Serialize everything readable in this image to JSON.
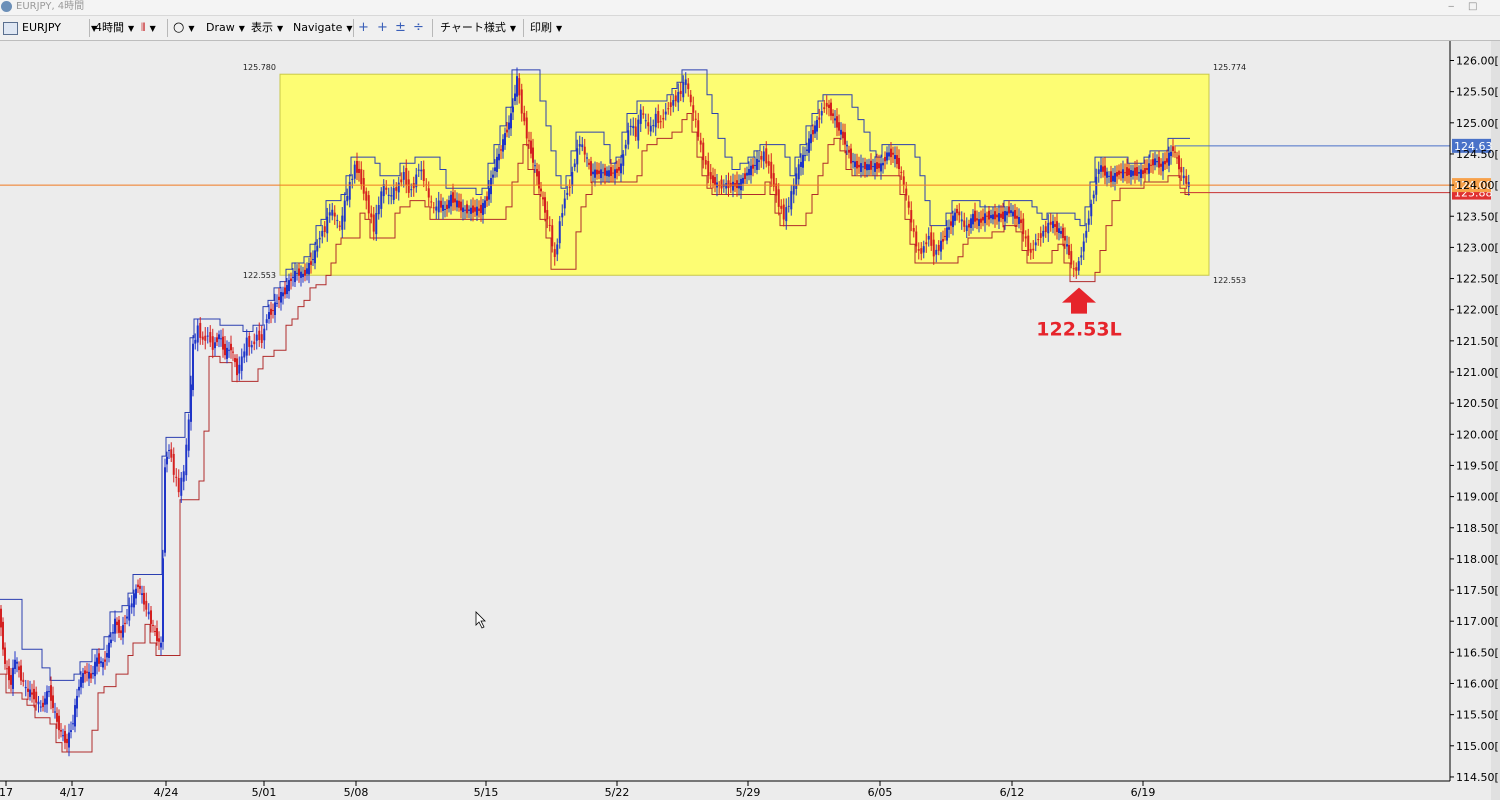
{
  "window": {
    "title": "EURJPY, 4時間",
    "minimize": "‒",
    "maximize": "□"
  },
  "toolbar": {
    "symbol": "EURJPY",
    "timeframe": "4時間",
    "draw": "Draw",
    "view": "表示",
    "navigate": "Navigate",
    "chart_style": "チャート様式",
    "print": "印刷"
  },
  "chart": {
    "range_box": {
      "high_left": "125.780",
      "high_right": "125.774",
      "low_left": "122.553",
      "low_right": "122.553"
    },
    "annotation": "122.53L",
    "price_labels": {
      "high": "124.63",
      "current": "124.00",
      "low": "123.88"
    },
    "colors": {
      "box": "#ffff66",
      "up": "#1f35c8",
      "down": "#d42020",
      "current_line": "#f07a20",
      "arrow": "#e6242b"
    },
    "cursor": "arrow-cursor"
  },
  "chart_data": {
    "type": "candlestick",
    "symbol": "EURJPY",
    "timeframe": "4時間",
    "y_ticks": [
      "126.00[",
      "125.50[",
      "125.00[",
      "124.50[",
      "124.00[",
      "123.50[",
      "123.00[",
      "122.50[",
      "122.00[",
      "121.50[",
      "121.00[",
      "120.50[",
      "120.00[",
      "119.50[",
      "119.00[",
      "118.50[",
      "118.00[",
      "117.50[",
      "117.00[",
      "116.50[",
      "116.00[",
      "115.50[",
      "115.00[",
      "114.50["
    ],
    "ylim": [
      114.5,
      126.2
    ],
    "x_ticks": [
      "17",
      "4/17",
      "4/24",
      "5/01",
      "5/08",
      "5/15",
      "5/22",
      "5/29",
      "6/05",
      "6/12",
      "6/19"
    ],
    "range_high": 125.78,
    "range_low": 122.553,
    "current_price": 124.0,
    "marked_low": 122.53,
    "path": [
      [
        0,
        117.2
      ],
      [
        6,
        116.3
      ],
      [
        12,
        116.0
      ],
      [
        16,
        116.4
      ],
      [
        22,
        116.1
      ],
      [
        27,
        115.9
      ],
      [
        35,
        115.8
      ],
      [
        42,
        115.6
      ],
      [
        50,
        115.9
      ],
      [
        56,
        115.5
      ],
      [
        62,
        115.2
      ],
      [
        68,
        115.05
      ],
      [
        74,
        115.4
      ],
      [
        80,
        116.0
      ],
      [
        86,
        116.2
      ],
      [
        92,
        116.1
      ],
      [
        98,
        116.4
      ],
      [
        104,
        116.3
      ],
      [
        110,
        116.6
      ],
      [
        116,
        117.0
      ],
      [
        122,
        116.8
      ],
      [
        128,
        117.1
      ],
      [
        133,
        117.3
      ],
      [
        139,
        117.6
      ],
      [
        145,
        117.3
      ],
      [
        150,
        117.1
      ],
      [
        156,
        116.8
      ],
      [
        162,
        116.6
      ],
      [
        166,
        119.5
      ],
      [
        170,
        119.8
      ],
      [
        175,
        119.4
      ],
      [
        180,
        119.1
      ],
      [
        185,
        119.4
      ],
      [
        190,
        120.2
      ],
      [
        194,
        121.4
      ],
      [
        199,
        121.7
      ],
      [
        204,
        121.5
      ],
      [
        209,
        121.6
      ],
      [
        214,
        121.4
      ],
      [
        220,
        121.6
      ],
      [
        226,
        121.3
      ],
      [
        232,
        121.4
      ],
      [
        238,
        121.0
      ],
      [
        243,
        121.2
      ],
      [
        248,
        121.5
      ],
      [
        253,
        121.4
      ],
      [
        258,
        121.6
      ],
      [
        263,
        121.5
      ],
      [
        268,
        121.9
      ],
      [
        274,
        122.0
      ],
      [
        280,
        122.2
      ],
      [
        286,
        122.3
      ],
      [
        292,
        122.5
      ],
      [
        298,
        122.6
      ],
      [
        304,
        122.55
      ],
      [
        310,
        122.7
      ],
      [
        316,
        122.9
      ],
      [
        321,
        123.2
      ],
      [
        326,
        123.3
      ],
      [
        331,
        123.6
      ],
      [
        336,
        123.5
      ],
      [
        341,
        123.3
      ],
      [
        346,
        123.7
      ],
      [
        351,
        124.0
      ],
      [
        356,
        124.3
      ],
      [
        360,
        124.2
      ],
      [
        365,
        123.9
      ],
      [
        370,
        123.6
      ],
      [
        375,
        123.3
      ],
      [
        380,
        123.7
      ],
      [
        385,
        124.0
      ],
      [
        390,
        123.8
      ],
      [
        395,
        123.9
      ],
      [
        400,
        124.0
      ],
      [
        405,
        124.2
      ],
      [
        410,
        123.9
      ],
      [
        415,
        124.0
      ],
      [
        420,
        124.3
      ],
      [
        425,
        124.1
      ],
      [
        430,
        123.8
      ],
      [
        435,
        123.6
      ],
      [
        440,
        123.7
      ],
      [
        446,
        123.6
      ],
      [
        452,
        123.8
      ],
      [
        458,
        123.7
      ],
      [
        464,
        123.6
      ],
      [
        470,
        123.6
      ],
      [
        476,
        123.6
      ],
      [
        482,
        123.6
      ],
      [
        488,
        123.8
      ],
      [
        494,
        124.2
      ],
      [
        500,
        124.5
      ],
      [
        506,
        124.8
      ],
      [
        512,
        125.1
      ],
      [
        518,
        125.7
      ],
      [
        523,
        125.2
      ],
      [
        528,
        124.8
      ],
      [
        534,
        124.4
      ],
      [
        540,
        124.0
      ],
      [
        546,
        123.6
      ],
      [
        551,
        123.3
      ],
      [
        556,
        122.8
      ],
      [
        561,
        123.4
      ],
      [
        566,
        123.8
      ],
      [
        571,
        124.0
      ],
      [
        576,
        124.4
      ],
      [
        581,
        124.7
      ],
      [
        586,
        124.5
      ],
      [
        592,
        124.2
      ],
      [
        598,
        124.2
      ],
      [
        604,
        124.2
      ],
      [
        610,
        124.2
      ],
      [
        616,
        124.2
      ],
      [
        622,
        124.3
      ],
      [
        627,
        124.7
      ],
      [
        632,
        125.0
      ],
      [
        637,
        124.8
      ],
      [
        642,
        125.2
      ],
      [
        647,
        125.0
      ],
      [
        652,
        124.9
      ],
      [
        657,
        125.1
      ],
      [
        662,
        125.0
      ],
      [
        667,
        125.2
      ],
      [
        672,
        125.3
      ],
      [
        677,
        125.4
      ],
      [
        682,
        125.5
      ],
      [
        687,
        125.7
      ],
      [
        692,
        125.3
      ],
      [
        697,
        125.0
      ],
      [
        702,
        124.6
      ],
      [
        707,
        124.3
      ],
      [
        712,
        124.1
      ],
      [
        718,
        124.0
      ],
      [
        725,
        124.0
      ],
      [
        732,
        124.0
      ],
      [
        740,
        124.0
      ],
      [
        748,
        124.2
      ],
      [
        754,
        124.3
      ],
      [
        760,
        124.4
      ],
      [
        765,
        124.5
      ],
      [
        770,
        124.3
      ],
      [
        775,
        124.0
      ],
      [
        780,
        123.7
      ],
      [
        785,
        123.5
      ],
      [
        790,
        123.7
      ],
      [
        795,
        124.0
      ],
      [
        800,
        124.3
      ],
      [
        806,
        124.5
      ],
      [
        812,
        124.8
      ],
      [
        818,
        125.0
      ],
      [
        823,
        125.2
      ],
      [
        828,
        125.3
      ],
      [
        834,
        125.1
      ],
      [
        840,
        124.9
      ],
      [
        846,
        124.7
      ],
      [
        852,
        124.4
      ],
      [
        858,
        124.3
      ],
      [
        864,
        124.3
      ],
      [
        870,
        124.3
      ],
      [
        876,
        124.3
      ],
      [
        882,
        124.3
      ],
      [
        888,
        124.5
      ],
      [
        894,
        124.5
      ],
      [
        900,
        124.3
      ],
      [
        905,
        124.0
      ],
      [
        910,
        123.6
      ],
      [
        915,
        123.2
      ],
      [
        920,
        122.9
      ],
      [
        925,
        123.0
      ],
      [
        930,
        123.2
      ],
      [
        935,
        122.9
      ],
      [
        940,
        123.0
      ],
      [
        946,
        123.2
      ],
      [
        952,
        123.4
      ],
      [
        958,
        123.6
      ],
      [
        963,
        123.4
      ],
      [
        968,
        123.3
      ],
      [
        974,
        123.5
      ],
      [
        980,
        123.4
      ],
      [
        986,
        123.5
      ],
      [
        992,
        123.5
      ],
      [
        998,
        123.5
      ],
      [
        1004,
        123.5
      ],
      [
        1010,
        123.6
      ],
      [
        1016,
        123.5
      ],
      [
        1022,
        123.4
      ],
      [
        1027,
        123.1
      ],
      [
        1032,
        122.9
      ],
      [
        1037,
        123.1
      ],
      [
        1042,
        123.2
      ],
      [
        1047,
        123.3
      ],
      [
        1052,
        123.4
      ],
      [
        1058,
        123.3
      ],
      [
        1064,
        123.2
      ],
      [
        1070,
        122.9
      ],
      [
        1075,
        122.6
      ],
      [
        1080,
        122.75
      ],
      [
        1085,
        123.1
      ],
      [
        1090,
        123.5
      ],
      [
        1095,
        123.9
      ],
      [
        1100,
        124.3
      ],
      [
        1106,
        124.2
      ],
      [
        1112,
        124.1
      ],
      [
        1120,
        124.2
      ],
      [
        1128,
        124.2
      ],
      [
        1136,
        124.2
      ],
      [
        1144,
        124.2
      ],
      [
        1150,
        124.3
      ],
      [
        1156,
        124.4
      ],
      [
        1162,
        124.3
      ],
      [
        1168,
        124.4
      ],
      [
        1174,
        124.6
      ],
      [
        1180,
        124.3
      ],
      [
        1185,
        124.1
      ],
      [
        1190,
        124.0
      ]
    ]
  }
}
